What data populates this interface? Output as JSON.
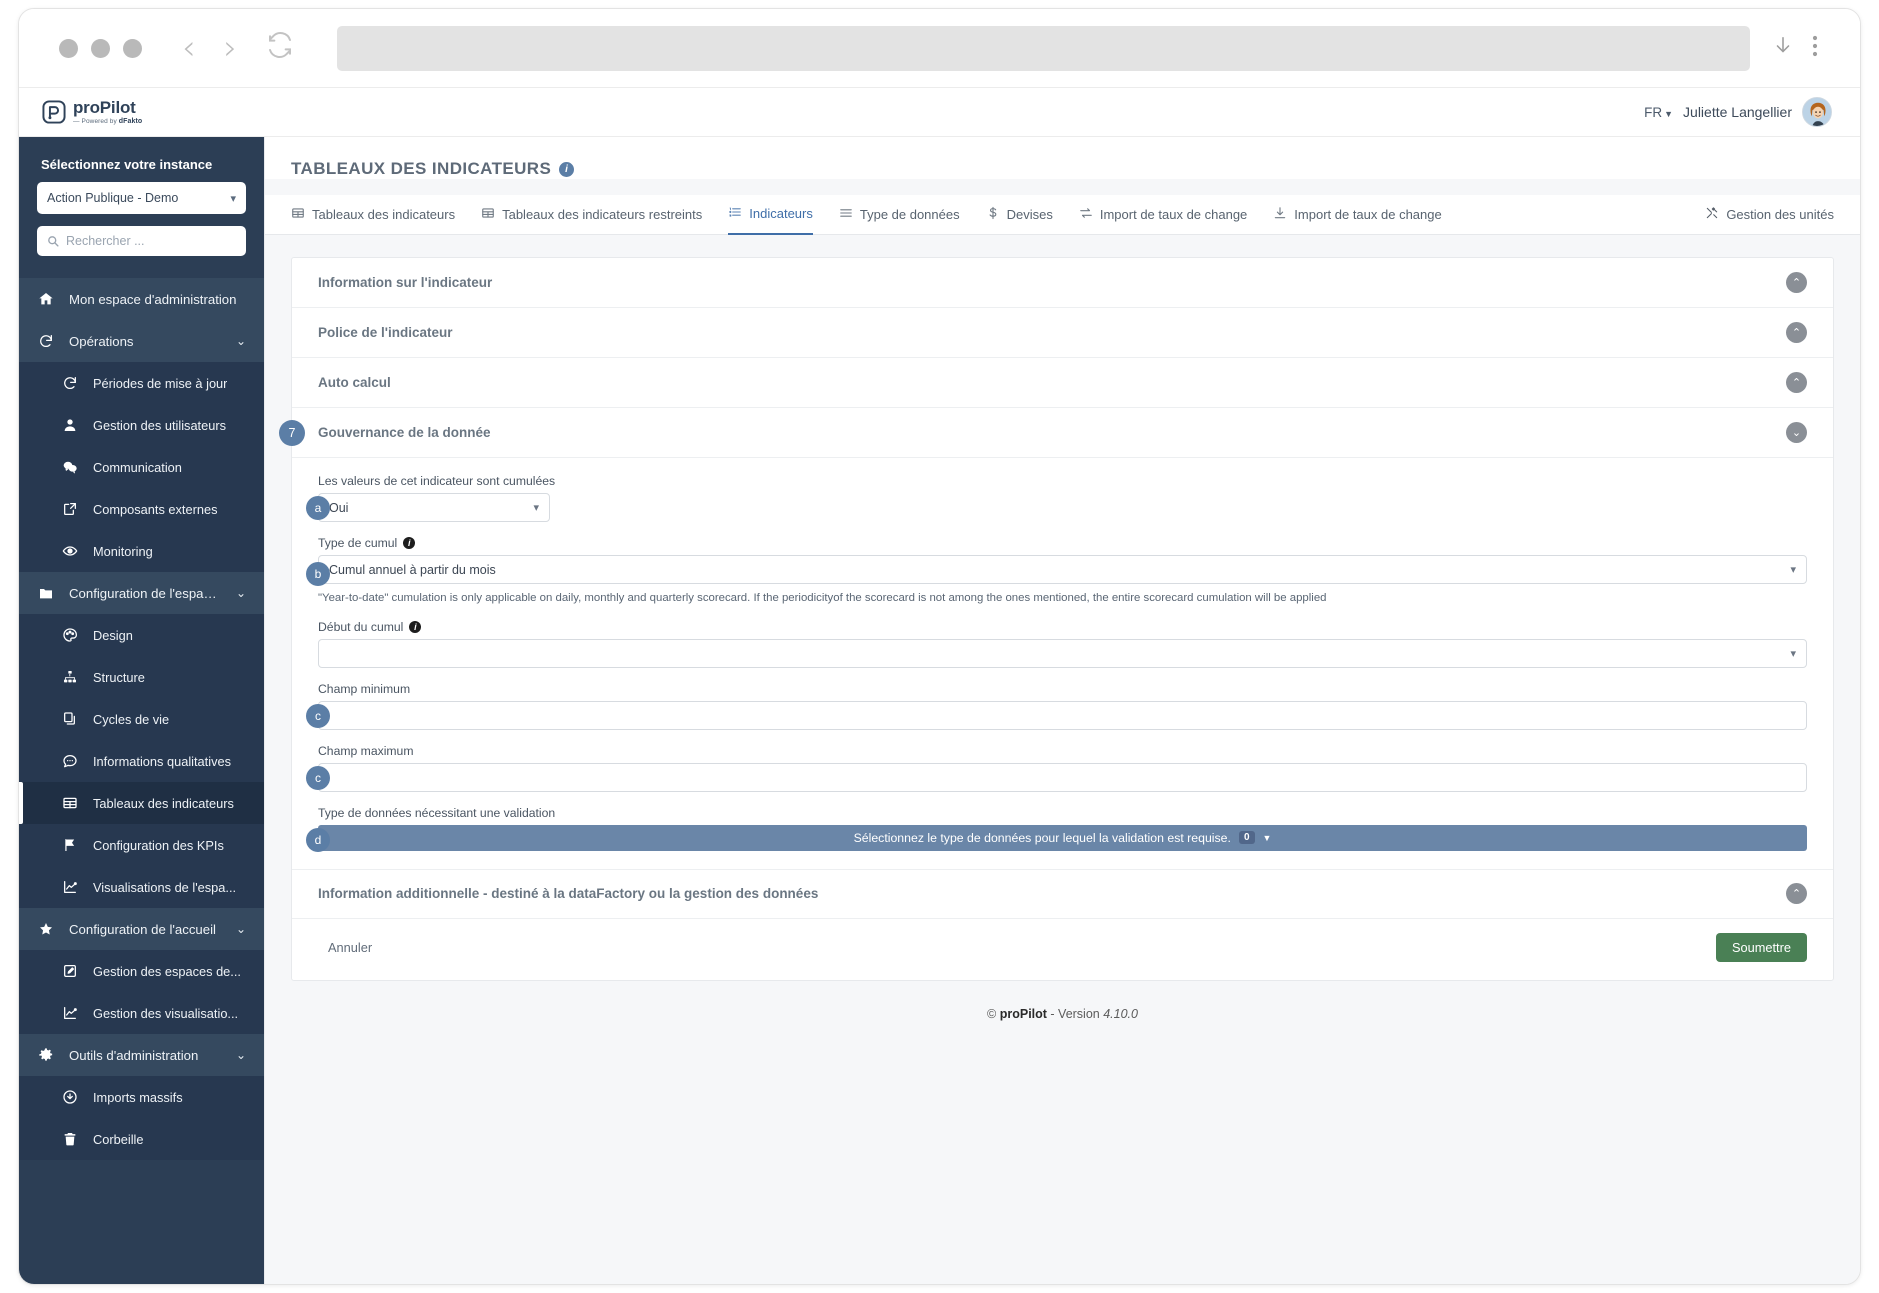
{
  "browser": {
    "back_icon": "chevron-left-icon",
    "forward_icon": "chevron-right-icon",
    "reload_icon": "reload-icon",
    "download_icon": "download-icon",
    "menu_icon": "kebab-menu-icon",
    "url_value": ""
  },
  "header": {
    "logo_name": "proPilot",
    "logo_sub_prefix": "— Powered by ",
    "logo_sub_brand": "dFakto",
    "language": "FR",
    "user_name": "Juliette Langellier"
  },
  "sidebar": {
    "title": "Sélectionnez votre instance",
    "instance_value": "Action Publique - Demo",
    "search_placeholder": "Rechercher ...",
    "items": [
      {
        "label": "Mon espace d'administration",
        "icon": "home-icon",
        "level": "group",
        "chevron": ""
      },
      {
        "label": "Opérations",
        "icon": "refresh-icon",
        "level": "group",
        "chevron": "⌄"
      },
      {
        "label": "Périodes de mise à jour",
        "icon": "refresh-icon",
        "level": "sub",
        "chevron": ""
      },
      {
        "label": "Gestion des utilisateurs",
        "icon": "user-icon",
        "level": "sub",
        "chevron": ""
      },
      {
        "label": "Communication",
        "icon": "chat-icon",
        "level": "sub",
        "chevron": ""
      },
      {
        "label": "Composants externes",
        "icon": "external-share-icon",
        "level": "sub",
        "chevron": ""
      },
      {
        "label": "Monitoring",
        "icon": "eye-icon",
        "level": "sub",
        "chevron": ""
      },
      {
        "label": "Configuration de l'espace de ...",
        "icon": "folder-icon",
        "level": "group",
        "chevron": "⌄"
      },
      {
        "label": "Design",
        "icon": "palette-icon",
        "level": "sub",
        "chevron": ""
      },
      {
        "label": "Structure",
        "icon": "sitemap-icon",
        "level": "sub",
        "chevron": ""
      },
      {
        "label": "Cycles de vie",
        "icon": "copy-icon",
        "level": "sub",
        "chevron": ""
      },
      {
        "label": "Informations qualitatives",
        "icon": "comment-dots-icon",
        "level": "sub",
        "chevron": ""
      },
      {
        "label": "Tableaux des indicateurs",
        "icon": "table-icon",
        "level": "sub-active",
        "chevron": ""
      },
      {
        "label": "Configuration des KPIs",
        "icon": "flag-icon",
        "level": "sub",
        "chevron": ""
      },
      {
        "label": "Visualisations de l'espa...",
        "icon": "chart-line-icon",
        "level": "sub",
        "chevron": ""
      },
      {
        "label": "Configuration de l'accueil",
        "icon": "star-icon",
        "level": "group",
        "chevron": "⌄"
      },
      {
        "label": "Gestion des espaces de...",
        "icon": "edit-icon",
        "level": "sub",
        "chevron": ""
      },
      {
        "label": "Gestion des visualisatio...",
        "icon": "chart-line-icon",
        "level": "sub",
        "chevron": ""
      },
      {
        "label": "Outils d'administration",
        "icon": "gear-icon",
        "level": "group",
        "chevron": "⌄"
      },
      {
        "label": "Imports massifs",
        "icon": "download-circle-icon",
        "level": "sub",
        "chevron": ""
      },
      {
        "label": "Corbeille",
        "icon": "trash-icon",
        "level": "sub",
        "chevron": ""
      }
    ]
  },
  "page": {
    "title": "TABLEAUX DES INDICATEURS",
    "info_icon": "info-icon"
  },
  "tabs": [
    {
      "label": "Tableaux des indicateurs",
      "icon": "table-icon",
      "active": false
    },
    {
      "label": "Tableaux des indicateurs restreints",
      "icon": "table-icon",
      "active": false
    },
    {
      "label": "Indicateurs",
      "icon": "list-ol-icon",
      "active": true
    },
    {
      "label": "Type de données",
      "icon": "list-icon",
      "active": false
    },
    {
      "label": "Devises",
      "icon": "dollar-icon",
      "active": false
    },
    {
      "label": "Import de taux de change",
      "icon": "exchange-icon",
      "active": false
    },
    {
      "label": "Import de taux de change",
      "icon": "download-icon",
      "active": false
    }
  ],
  "tab_right": {
    "label": "Gestion des unités",
    "icon": "tools-icon"
  },
  "sections": [
    {
      "title": "Information sur l'indicateur",
      "collapsed": true,
      "chevron": "⌃"
    },
    {
      "title": "Police de l'indicateur",
      "collapsed": true,
      "chevron": "⌃"
    },
    {
      "title": "Auto calcul",
      "collapsed": true,
      "chevron": "⌃"
    },
    {
      "title": "Gouvernance de la donnée",
      "collapsed": false,
      "chevron": "⌄",
      "step": "7"
    }
  ],
  "form": {
    "cumul_label": "Les valeurs de cet indicateur sont cumulées",
    "cumul_value": "Oui",
    "cumul_badge": "a",
    "type_cumul_label": "Type de cumul",
    "type_cumul_value": "Cumul annuel à partir du mois",
    "type_cumul_badge": "b",
    "hint": "\"Year-to-date\" cumulation is only applicable on daily, monthly and quarterly scorecard. If the periodicityof the scorecard is not among the ones mentioned, the entire scorecard cumulation will be applied",
    "debut_cumul_label": "Début du cumul",
    "debut_cumul_value": "",
    "champ_min_label": "Champ minimum",
    "champ_min_value": "",
    "champ_min_badge": "c",
    "champ_max_label": "Champ maximum",
    "champ_max_value": "",
    "champ_max_badge": "c",
    "validation_label": "Type de données nécessitant une validation",
    "validation_badge": "d",
    "validation_placeholder": "Sélectionnez le type de données pour lequel la validation est requise.",
    "validation_count": "0"
  },
  "additional_section": {
    "title": "Information additionnelle - destiné à la dataFactory ou la gestion des données",
    "chevron": "⌃"
  },
  "actions": {
    "cancel_label": "Annuler",
    "submit_label": "Soumettre"
  },
  "footer": {
    "copyright": "©",
    "brand": "proPilot",
    "separator": " - Version ",
    "version": "4.10.0"
  },
  "colors": {
    "sidebar_bg": "#2c3e55",
    "accent_blue": "#5b7ea6",
    "tab_active": "#3f6ea8",
    "submit_green": "#4a8055",
    "multiselect_bg": "#6a86a8"
  }
}
